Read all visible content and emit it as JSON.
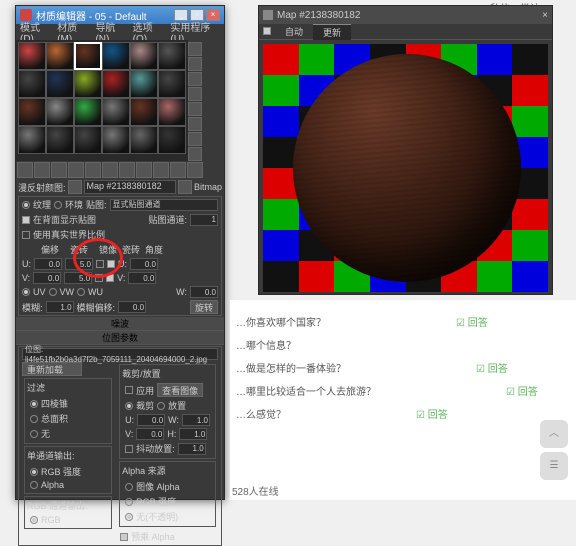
{
  "header_tabs": [
    "私信",
    "常访"
  ],
  "material_editor": {
    "title": "材质编辑器 - 05 - Default",
    "menu": [
      "模式(D)",
      "材质(M)",
      "导航(N)",
      "选项(O)",
      "实用程序(U)"
    ],
    "slot_colors": [
      "#c44",
      "#b63",
      "#632",
      "#158",
      "#a88",
      "#555",
      "#444",
      "#235",
      "#8a2",
      "#a22",
      "#599",
      "#444",
      "#632",
      "#888",
      "#3a4",
      "#777",
      "#632",
      "#a66",
      "#777",
      "#444",
      "#444",
      "#777",
      "#666",
      "#333"
    ],
    "selected_slot": 2,
    "map_label": "漫反射颜图:",
    "map_name": "Map #2138380182",
    "map_type": "Bitmap",
    "coords": {
      "texture": "纹理",
      "environ": "环境",
      "mapping_label": "贴图:",
      "mapping_value": "显式贴图通道",
      "realworld": "在背面显示贴图",
      "use_realworld": "使用真实世界比例",
      "channel_label": "贴图通道:",
      "channel": "1",
      "offset_label": "偏移",
      "tile_label": "瓷砖",
      "mirror_label": "镜像",
      "tile2_label": "瓷砖",
      "angle_label": "角度",
      "u_offset": "0.0",
      "u_tile": "5.0",
      "u_angle": "0.0",
      "v_offset": "0.0",
      "v_tile": "5.0",
      "v_angle": "0.0",
      "w_angle": "0.0",
      "uv_label": "UV",
      "vw_label": "VW",
      "wu_label": "WU",
      "blur_label": "模糊:",
      "blur": "1.0",
      "blur_offset_label": "模糊偏移:",
      "blur_offset": "0.0",
      "rotate": "旋转"
    },
    "noise_header": "噪波",
    "bitmap_header": "位图参数",
    "bitmap_path": "位图: li4fe51fb2b0a3d7f2b_7059111_20404694000_2.jpg",
    "reload": "重新加载",
    "crop": {
      "header": "裁剪/放置",
      "apply": "应用",
      "view": "查看图像",
      "crop_r": "裁剪",
      "place_r": "放置",
      "u": "0.0",
      "v": "0.0",
      "w": "1.0",
      "h": "1.0",
      "jitter_chk": "抖动放置:",
      "jitter": "1.0"
    },
    "filter": {
      "header": "过滤",
      "pyramidal": "四棱锥",
      "summed": "总面积",
      "none": "无"
    },
    "mono": {
      "header": "单通道输出:",
      "rgb": "RGB 强度",
      "alpha": "Alpha"
    },
    "rgb_out": {
      "header": "RGB 通道输出:",
      "rgb": "RGB"
    },
    "alpha_src": {
      "header": "Alpha 来源",
      "image": "图像 Alpha",
      "rgb": "RGB 强度",
      "none": "无(不透明)"
    },
    "premult": "预乘 Alpha"
  },
  "preview": {
    "title": "Map #2138380182",
    "tab_auto": "自动",
    "tab_update": "更新"
  },
  "web": {
    "q1": "…你喜欢哪个国家？",
    "q2": "…哪个信息？",
    "q3": "…做是怎样的一番体验？",
    "q4": "…哪里比较适合一个人去旅游？",
    "q5": "…么感觉？",
    "reply": "回答"
  },
  "status": "528人在线"
}
